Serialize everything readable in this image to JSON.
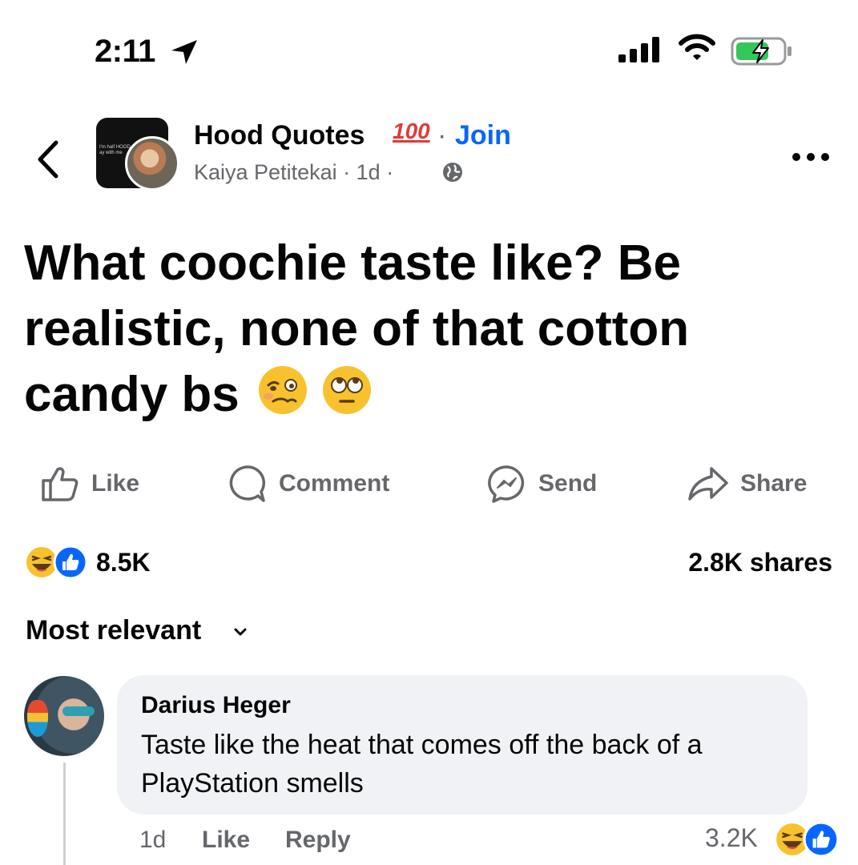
{
  "status_bar": {
    "time": "2:11"
  },
  "header": {
    "group_name": "Hood Quotes",
    "badge": "100",
    "join_separator": "·",
    "join_label": "Join",
    "author": "Kaiya Petitekai",
    "age": "1d",
    "meta_sep": "·",
    "avatar_tiny_text": "I'm half HOOD\nay with me"
  },
  "post": {
    "text": "What coochie taste like? Be realistic, none of that cotton candy bs"
  },
  "actions": {
    "like": "Like",
    "comment": "Comment",
    "send": "Send",
    "share": "Share"
  },
  "engagement": {
    "reaction_count": "8.5K",
    "shares": "2.8K shares"
  },
  "comments_sort": {
    "label": "Most relevant"
  },
  "comment": {
    "author": "Darius Heger",
    "text": "Taste like the heat that comes off the back of a PlayStation smells",
    "time": "1d",
    "like": "Like",
    "reply": "Reply",
    "reaction_count": "3.2K"
  },
  "colors": {
    "accent": "#0866ff",
    "secondary_text": "#65676b",
    "bubble": "#f0f2f5",
    "battery": "#34c759"
  },
  "icons": [
    "location-arrow-icon",
    "cellular-signal-icon",
    "wifi-icon",
    "battery-charging-icon",
    "back-chevron-icon",
    "globe-icon",
    "more-options-icon",
    "like-icon",
    "comment-icon",
    "messenger-icon",
    "share-icon",
    "haha-reaction-icon",
    "like-reaction-icon",
    "chevron-down-icon",
    "woozy-face-emoji",
    "eye-roll-emoji"
  ]
}
